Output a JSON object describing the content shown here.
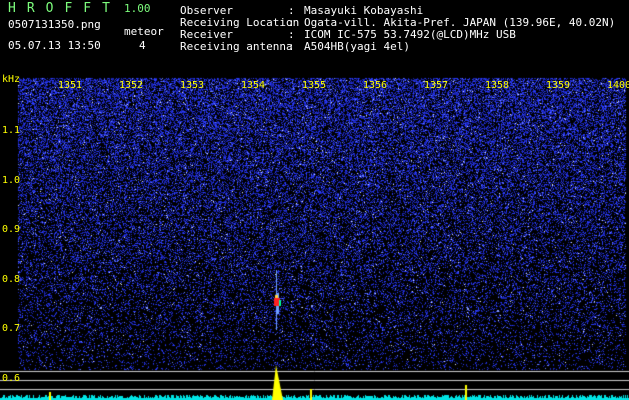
{
  "app": {
    "title": "HROFFT",
    "version": "1.00",
    "filename": "0507131350.png",
    "datetime": "05.07.13 13:50",
    "counter_label": "meteor",
    "counter_value": "4"
  },
  "info": [
    {
      "label": "Observer",
      "value": "Masayuki Kobayashi"
    },
    {
      "label": "Receiving Location",
      "value": "Ogata-vill. Akita-Pref. JAPAN (139.96E, 40.02N)"
    },
    {
      "label": "Receiver",
      "value": "ICOM IC-575 53.7492(@LCD)MHz USB"
    },
    {
      "label": "Receiving antenna",
      "value": "A504HB(yagi 4el)"
    }
  ],
  "chart_data": {
    "type": "heatmap",
    "ylabel": "kHz",
    "x_ticks": [
      "1351",
      "1352",
      "1353",
      "1354",
      "1355",
      "1356",
      "1357",
      "1358",
      "1359",
      "1400"
    ],
    "y_ticks": [
      "1.1",
      "1.0",
      "0.9",
      "0.8",
      "0.7",
      "0.6"
    ],
    "ylim": [
      0.57,
      1.22
    ],
    "events": [
      {
        "time": "1354.5",
        "freq_khz": 0.75,
        "intensity": "strong"
      }
    ],
    "colors": {
      "background": "#000000",
      "noise": "#2b3cff",
      "signal": "#ff2020",
      "spectrum": "#00e5e5",
      "peak": "#ffff00"
    }
  }
}
